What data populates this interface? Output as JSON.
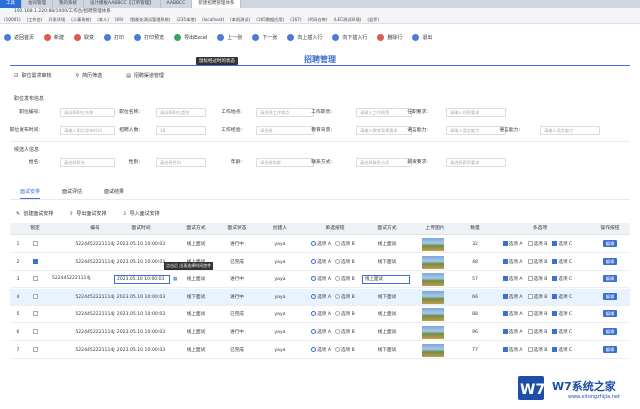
{
  "browser": {
    "tabs": [
      "工具",
      "会同管理",
      "我的系统",
      "设计模板AABBCC【订单管理】",
      "AABBCC",
      "新建招聘管理体系"
    ],
    "address": "192.168.1.220:88/1000/工作台/招聘管理体系",
    "bookmarks": [
      "(10001)",
      "(工作台)",
      "开发环境",
      "(人事系统)",
      "(本人)",
      "(E9)",
      "(智能化测试管理系统)",
      "(235本地)",
      "(localhost)",
      "(本机测试)",
      "(165数据应用)",
      "(167)",
      "(代码仓库)",
      "(LEC测试环境)",
      "(益罗)"
    ]
  },
  "toolbar": {
    "items": [
      {
        "label": "返回首页",
        "color": "#4a7bd6"
      },
      {
        "label": "新建",
        "color": "#e0584e"
      },
      {
        "label": "取变",
        "color": "#e0584e"
      },
      {
        "label": "打印",
        "color": "#4a7bd6"
      },
      {
        "label": "打印预览",
        "color": "#4a7bd6"
      },
      {
        "label": "导出Excel",
        "color": "#3aa55d"
      },
      {
        "label": "上一张",
        "color": "#4a7bd6"
      },
      {
        "label": "下一张",
        "color": "#4a7bd6"
      },
      {
        "label": "向上插入行",
        "color": "#4a7bd6"
      },
      {
        "label": "向下插入行",
        "color": "#4a7bd6"
      },
      {
        "label": "删除行",
        "color": "#e0584e"
      },
      {
        "label": "退出",
        "color": "#4a7bd6"
      }
    ],
    "tooltip": "鼠标经过时的状态"
  },
  "title": "招聘管理",
  "subnav": [
    "职位需求审核",
    "简历筛选",
    "招聘渠道管理"
  ],
  "section1": "职位发布信息",
  "section2": "候选人信息",
  "form": {
    "r1": [
      {
        "label": "职位编号:",
        "ph": "请选择职位名称"
      },
      {
        "label": "职位名称:",
        "ph": "请选择职位类别"
      },
      {
        "label": "工作地点:",
        "ph": "请选择工作地点"
      },
      {
        "label": "工作职责:",
        "ph": "请输入工作职责"
      },
      {
        "label": "任职要求:",
        "ph": "请输入任职要求"
      }
    ],
    "r2": [
      {
        "label": "职位发布时间:",
        "ph": "请输入职位发布时间"
      },
      {
        "label": "招聘人数:",
        "ph": "18"
      },
      {
        "label": "工作经验:",
        "ph": "请选择"
      },
      {
        "label": "教育背景:",
        "ph": "请输入教育背景要求"
      },
      {
        "label": "语言能力:",
        "ph": "请输入语言能力"
      },
      {
        "label": "语言能力:",
        "ph": "请输入语言能力"
      }
    ],
    "r3": [
      {
        "label": "姓名:",
        "ph": "请选择姓名"
      },
      {
        "label": "性别:",
        "ph": "请选择性别"
      },
      {
        "label": "年龄:",
        "ph": "请选择年龄"
      },
      {
        "label": "联系方式:",
        "ph": "请选择联系方式"
      },
      {
        "label": "薪资要求:",
        "ph": "请选择薪资要求"
      }
    ]
  },
  "tabs2": [
    "面试安排",
    "面试评估",
    "面试结果"
  ],
  "actions": [
    "创建面试安排",
    "导出面试安排",
    "导入面试安排"
  ],
  "tip2": "点击后 出现选择时间控件",
  "columns": [
    "锁定",
    "编号",
    "面试时间",
    "面试方式",
    "面试状态",
    "创建人",
    "单选按钮",
    "面试方式",
    "上传图片",
    "数量",
    "多选项",
    "操作按钮"
  ],
  "rows": [
    {
      "n": "1",
      "lock": false,
      "code": "5224452221114J",
      "time": "2023.05.10 10:00:03",
      "mode": "线上面试",
      "status": "进行中",
      "creator": "yaya",
      "radio": 0,
      "mode2": "线上面试",
      "qty": "32",
      "checks": [
        true,
        false,
        true
      ]
    },
    {
      "n": "2",
      "lock": true,
      "code": "5224452221114J",
      "time": "2023.05.10 10:00:03",
      "mode": "线上面试",
      "status": "已完成",
      "creator": "yaya",
      "radio": 0,
      "mode2": "线下面试",
      "qty": "48",
      "checks": [
        true,
        false,
        true
      ]
    },
    {
      "n": "3",
      "lock": false,
      "code": "5224452221114J",
      "time": "2023.05.10 10:00:03",
      "mode": "线上面试",
      "status": "进行中",
      "creator": "yaya",
      "radio": 0,
      "mode2": "线上面试",
      "qty": "57",
      "checks": [
        true,
        false,
        true
      ]
    },
    {
      "n": "4",
      "lock": false,
      "code": "5224452221114J",
      "time": "2023.05.10 10:00:03",
      "mode": "线下面试",
      "status": "进行中",
      "creator": "yaya",
      "radio": 0,
      "mode2": "线下面试",
      "qty": "66",
      "checks": [
        true,
        false,
        true
      ]
    },
    {
      "n": "5",
      "lock": false,
      "code": "5224452221114J",
      "time": "2023.05.10 10:00:03",
      "mode": "线上面试",
      "status": "已完成",
      "creator": "yaya",
      "radio": 0,
      "mode2": "线上面试",
      "qty": "88",
      "checks": [
        true,
        false,
        true
      ]
    },
    {
      "n": "6",
      "lock": false,
      "code": "5224452221114J",
      "time": "2023.05.10 10:00:03",
      "mode": "线上面试",
      "status": "进行中",
      "creator": "yaya",
      "radio": 0,
      "mode2": "线上面试",
      "qty": "96",
      "checks": [
        true,
        false,
        true
      ]
    },
    {
      "n": "7",
      "lock": false,
      "code": "5224452221114J",
      "time": "2023.05.10 10:00:03",
      "mode": "线上面试",
      "status": "已完成",
      "creator": "yaya",
      "radio": 0,
      "mode2": "线下面试",
      "qty": "77",
      "checks": [
        true,
        false,
        true
      ]
    }
  ],
  "radio_labels": [
    "选项 A",
    "选项 B"
  ],
  "check_labels": [
    "选项 A",
    "选项 B",
    "选项 C"
  ],
  "edit_label": "编辑",
  "watermark": {
    "text": "W7系统之家",
    "url": "www.xitongzhijia.net"
  }
}
